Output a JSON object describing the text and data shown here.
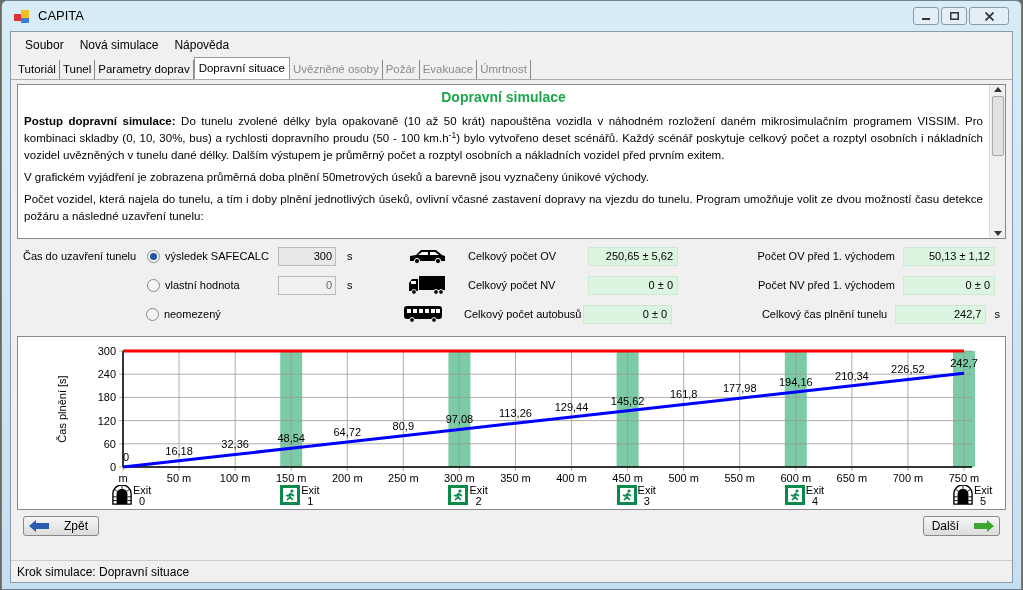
{
  "window": {
    "title": "CAPITA"
  },
  "menu": [
    "Soubor",
    "Nová simulace",
    "Nápověda"
  ],
  "tabs": [
    {
      "label": "Tutoriál",
      "selected": false,
      "disabled": false
    },
    {
      "label": "Tunel",
      "selected": false,
      "disabled": false
    },
    {
      "label": "Parametry doprav",
      "selected": false,
      "disabled": false
    },
    {
      "label": "Dopravní situace",
      "selected": true,
      "disabled": false
    },
    {
      "label": "Uvězněné osoby",
      "selected": false,
      "disabled": true
    },
    {
      "label": "Požár",
      "selected": false,
      "disabled": true
    },
    {
      "label": "Evakuace",
      "selected": false,
      "disabled": true
    },
    {
      "label": "Úmrtnost",
      "selected": false,
      "disabled": true
    }
  ],
  "info": {
    "heading": "Dopravní simulace",
    "paragraphs": [
      "**Postup dopravní simulace:** Do tunelu zvolené délky byla opakovaně (10 až 50 krát) napouštěna vozidla v náhodném rozložení daném mikrosimulačním programem VISSIM. Pro kombinaci skladby (0, 10, 30%, bus) a rychlosti dopravního proudu (50 - 100 km.h$^{-1}$) bylo vytvořeno deset scénářů. Každý scénář poskytuje celkový počet a rozptyl osobních i nákladních vozidel uvězněných v tunelu dané délky. Dalším výstupem je průměrný počet a rozptyl osobních a nákladních vozidel před prvním exitem.",
      "V grafickém vyjádření je zobrazena průměrná doba plnění 50metrových úseků a barevně jsou vyznačeny únikové východy.",
      "Počet vozidel, která najela do tunelu, a tím i doby plnění jednotlivých úseků, ovlivní včasné zastavení dopravy na vjezdu do tunelu. Program umožňuje volit ze dvou možností času detekce požáru a následné uzavření tunelu:"
    ]
  },
  "closure": {
    "label": "Čas do uzavření tunelu",
    "options": [
      {
        "label": "výsledek SAFECALC",
        "selected": true,
        "disabled": false,
        "value": "300",
        "unit": "s"
      },
      {
        "label": "vlastní hodnota",
        "selected": false,
        "disabled": true,
        "value": "0",
        "unit": "s"
      },
      {
        "label": "neomezený",
        "selected": false
      }
    ]
  },
  "totals": [
    {
      "kind": "car",
      "label": "Celkový počet OV",
      "value": "250,65 ± 5,62"
    },
    {
      "kind": "truck",
      "label": "Celkový počet NV",
      "value": "0 ± 0"
    },
    {
      "kind": "bus",
      "label": "Celkový počet autobusů",
      "value": "0 ± 0"
    }
  ],
  "before_exit": [
    {
      "label": "Počet OV před 1. východem",
      "value": "50,13 ± 1,12"
    },
    {
      "label": "Počet NV před 1. východem",
      "value": "0 ± 0"
    },
    {
      "label": "Celkový čas plnění tunelu",
      "value": "242,7",
      "unit": "s"
    }
  ],
  "chart": {
    "chart_data": {
      "type": "line",
      "ylabel": "Čas plnění [s]",
      "x": [
        0,
        50,
        100,
        150,
        200,
        250,
        300,
        350,
        400,
        450,
        500,
        550,
        600,
        650,
        700,
        750
      ],
      "xticks": [
        {
          "value": 0,
          "label": "m"
        },
        {
          "value": 50,
          "label": "50 m"
        },
        {
          "value": 100,
          "label": "100 m"
        },
        {
          "value": 150,
          "label": "150 m"
        },
        {
          "value": 200,
          "label": "200 m"
        },
        {
          "value": 250,
          "label": "250 m"
        },
        {
          "value": 300,
          "label": "300 m"
        },
        {
          "value": 350,
          "label": "350 m"
        },
        {
          "value": 400,
          "label": "400 m"
        },
        {
          "value": 450,
          "label": "450 m"
        },
        {
          "value": 500,
          "label": "500 m"
        },
        {
          "value": 550,
          "label": "550 m"
        },
        {
          "value": 600,
          "label": "600 m"
        },
        {
          "value": 650,
          "label": "650 m"
        },
        {
          "value": 700,
          "label": "700 m"
        },
        {
          "value": 750,
          "label": "750 m"
        }
      ],
      "yticks": [
        0,
        60,
        120,
        180,
        240,
        300
      ],
      "xlim": [
        0,
        750
      ],
      "ylim": [
        0,
        300
      ],
      "series": [
        {
          "color": "#0000ff",
          "values": [
            0,
            16.18,
            32.36,
            48.54,
            64.72,
            80.9,
            97.08,
            113.26,
            129.44,
            145.62,
            161.8,
            177.98,
            194.16,
            210.34,
            226.52,
            242.7
          ],
          "value_labels": [
            "0",
            "16,18",
            "32,36",
            "48,54",
            "64,72",
            "80,9",
            "97,08",
            "113,26",
            "129,44",
            "145,62",
            "161,8",
            "177,98",
            "194,16",
            "210,34",
            "226,52",
            "242,7"
          ]
        },
        {
          "color": "#ff0000",
          "values": [
            300,
            300,
            300,
            300,
            300,
            300,
            300,
            300,
            300,
            300,
            300,
            300,
            300,
            300,
            300,
            300
          ]
        }
      ],
      "grid": true
    },
    "exits": [
      {
        "kind": "portal",
        "label": "Exit",
        "number": "0",
        "highlighted": false
      },
      {
        "kind": "exit",
        "label": "Exit",
        "number": "1",
        "highlighted": true
      },
      {
        "kind": "exit",
        "label": "Exit",
        "number": "2",
        "highlighted": true
      },
      {
        "kind": "exit",
        "label": "Exit",
        "number": "3",
        "highlighted": true
      },
      {
        "kind": "exit",
        "label": "Exit",
        "number": "4",
        "highlighted": true
      },
      {
        "kind": "portal",
        "label": "Exit",
        "number": "5",
        "highlighted": true
      }
    ]
  },
  "buttons": {
    "back": "Zpět",
    "next": "Další"
  },
  "status_bar": "Krok simulace: Dopravní situace"
}
